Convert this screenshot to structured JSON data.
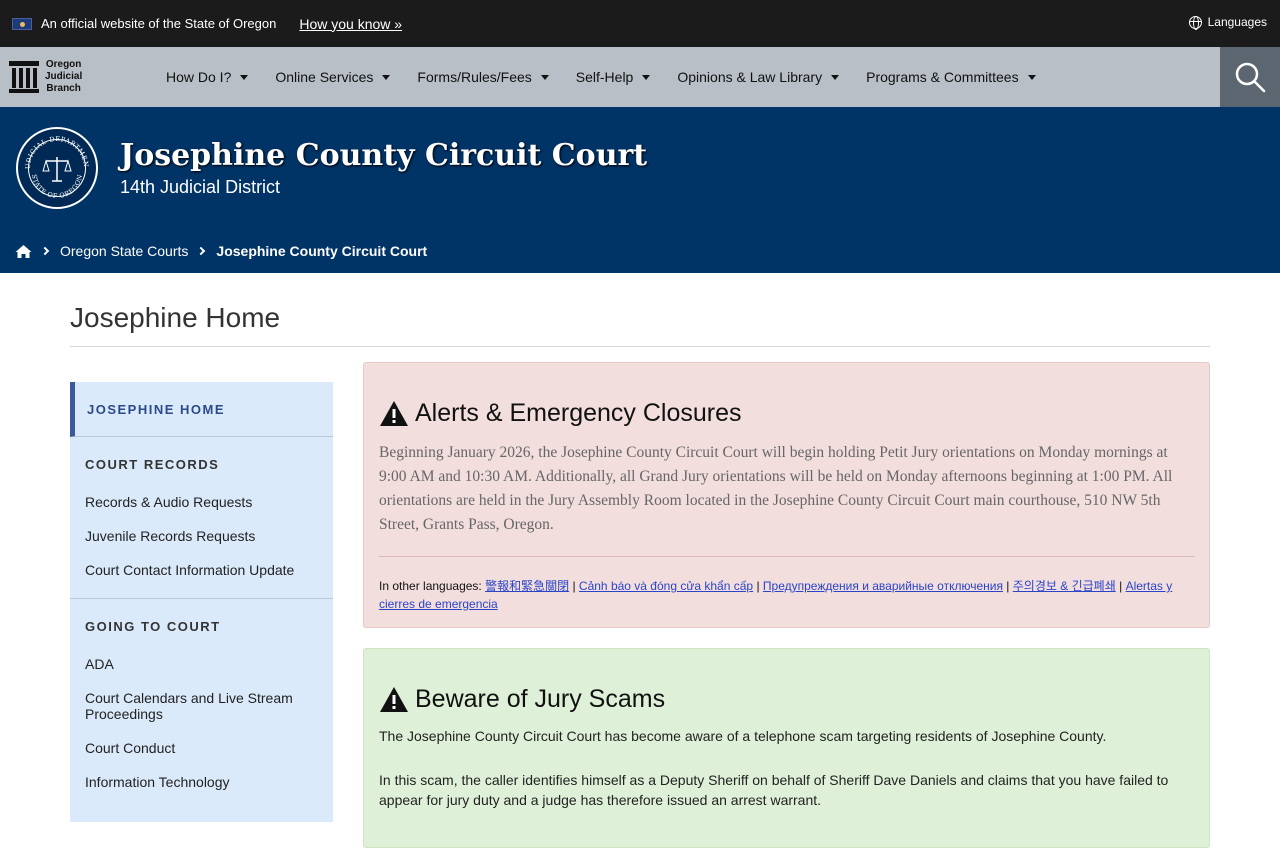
{
  "official_bar": {
    "text": "An official website of the State of Oregon",
    "how_link": "How you know »",
    "languages": "Languages"
  },
  "nav": {
    "brand": [
      "Oregon",
      "Judicial",
      "Branch"
    ],
    "items": [
      {
        "label": "How Do I?"
      },
      {
        "label": "Online Services"
      },
      {
        "label": "Forms/Rules/Fees"
      },
      {
        "label": "Self-Help"
      },
      {
        "label": "Opinions & Law Library"
      },
      {
        "label": "Programs & Committees"
      }
    ]
  },
  "header": {
    "title": "Josephine County Circuit Court",
    "subtitle": "14th Judicial District",
    "seal_text": [
      "JUDICIAL DEPARTMENT",
      "STATE OF OREGON"
    ],
    "breadcrumb": [
      "Oregon State Courts",
      "Josephine County Circuit Court"
    ]
  },
  "page": {
    "title": "Josephine Home"
  },
  "sidebar": {
    "home": "JOSEPHINE HOME",
    "sections": [
      {
        "heading": "COURT RECORDS",
        "links": [
          "Records & Audio Requests",
          "Juvenile Records Requests",
          "Court Contact Information Update"
        ]
      },
      {
        "heading": "GOING TO COURT",
        "links": [
          "ADA",
          "Court Calendars and Live Stream Proceedings",
          "Court Conduct",
          "Information Technology"
        ]
      }
    ]
  },
  "alert": {
    "heading": "Alerts & Emergency Closures",
    "body": "Beginning January 2026, the Josephine County Circuit Court will begin holding Petit Jury orientations on Monday mornings at 9:00 AM and 10:30 AM. Additionally, all Grand Jury orientations will be held on Monday afternoons beginning at 1:00 PM. All orientations are held in the Jury Assembly Room located in the Josephine County Circuit Court main courthouse, 510 NW 5th Street, Grants Pass, Oregon.",
    "lang_prefix": "In other languages:",
    "lang_links": [
      "警報和緊急關閉",
      "Cảnh báo và đóng cửa khẩn cấp",
      "Предупреждения и аварийные отключения",
      "주의경보 & 긴급폐쇄",
      "Alertas y cierres de emergencia"
    ],
    "separator": "|"
  },
  "scam": {
    "heading": "Beware of Jury Scams",
    "p1": "The Josephine County Circuit Court has become aware of a telephone scam targeting residents of Josephine County.",
    "p2": "In this scam, the caller identifies himself as a Deputy Sheriff on behalf of Sheriff Dave Daniels and claims that you have failed to appear for jury duty and a judge has therefore issued an arrest warrant."
  },
  "colors": {
    "header_blue": "#003366",
    "nav_gray": "#b8bfc6",
    "alert_pink": "#f3dede",
    "scam_green": "#dff0d8",
    "sidebar_blue": "#dbeafa"
  }
}
